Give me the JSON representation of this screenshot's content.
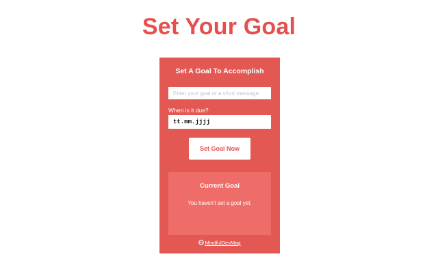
{
  "page": {
    "title": "Set Your Goal"
  },
  "panel": {
    "title": "Set A Goal To Accomplish",
    "goal_input": {
      "placeholder": "Enter your goal or a short message",
      "value": ""
    },
    "due_label": "When is it due?",
    "due_input": {
      "value": "tt.mm.jjjj"
    },
    "set_button_label": "Set Goal Now"
  },
  "current_goal": {
    "title": "Current Goal",
    "message": "You haven't set a goal yet."
  },
  "footer": {
    "brand": "MindfulDevMag",
    "logo_icon": "mindful-logo-icon"
  },
  "colors": {
    "accent": "#e5504e",
    "panel_bg": "#e45853",
    "current_box_bg": "#ee6d68",
    "text_on_accent": "#ffffff"
  }
}
